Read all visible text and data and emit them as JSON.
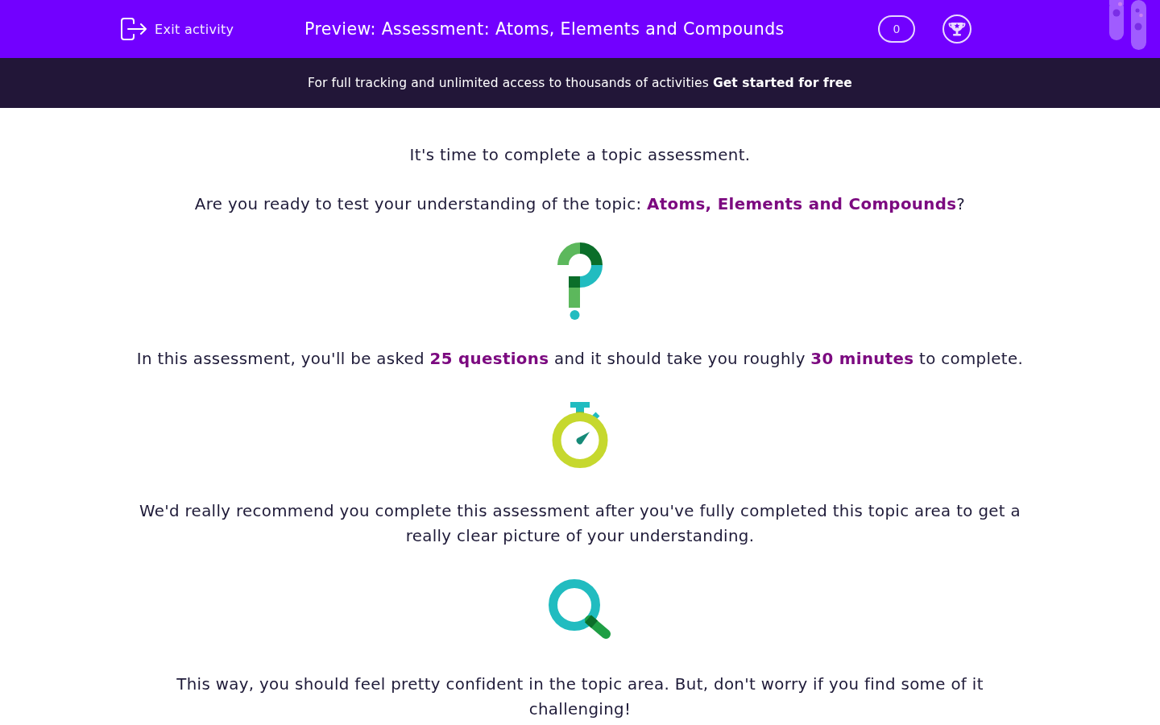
{
  "header": {
    "exit_label": "Exit activity",
    "title": "Preview: Assessment: Atoms, Elements and Compounds",
    "score": "0"
  },
  "banner": {
    "text": "For full tracking and unlimited access to thousands of activities",
    "link": "Get started for free"
  },
  "paragraphs": [
    "It's time to complete a topic assessment.",
    "Are you ready to test your understanding of the topic: **Atoms, Elements and Compounds**?",
    "In this assessment, you'll be asked **25 questions** and it should take you roughly **30 minutes** to complete.",
    "We'd really recommend you complete this assessment after you've fully completed this topic area to get a really clear picture of your understanding.",
    "This way, you should feel pretty confident in the topic area. But, don't worry if you find some of it challenging!"
  ]
}
